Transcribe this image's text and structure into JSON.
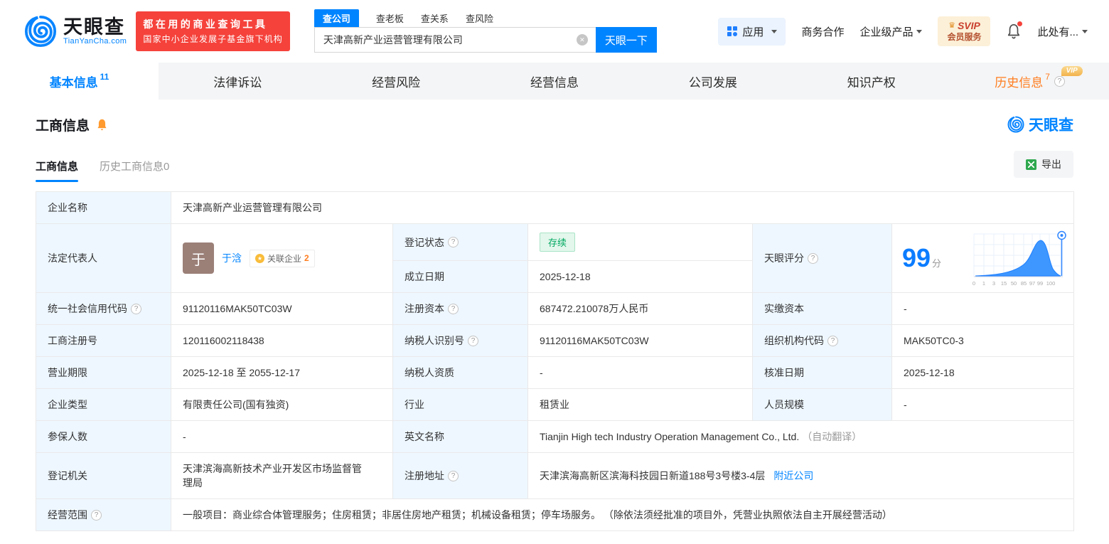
{
  "brand": {
    "name": "天眼查",
    "domain": "TianYanCha.com",
    "promo_line1": "都在用的商业查询工具",
    "promo_line2": "国家中小企业发展子基金旗下机构"
  },
  "search": {
    "tabs": [
      {
        "label": "查公司"
      },
      {
        "label": "查老板"
      },
      {
        "label": "查关系"
      },
      {
        "label": "查风险"
      }
    ],
    "value": "天津高新产业运营管理有限公司",
    "button_label": "天眼一下"
  },
  "header_nav": {
    "apps_label": "应用",
    "cooperation_label": "商务合作",
    "enterprise_label": "企业级产品",
    "svip_title": "SVIP",
    "svip_subtitle": "会员服务",
    "user_label": "此处有..."
  },
  "nav_tabs": [
    {
      "label": "基本信息",
      "count": "11"
    },
    {
      "label": "法律诉讼",
      "count": ""
    },
    {
      "label": "经营风险",
      "count": ""
    },
    {
      "label": "经营信息",
      "count": ""
    },
    {
      "label": "公司发展",
      "count": ""
    },
    {
      "label": "知识产权",
      "count": ""
    },
    {
      "label": "历史信息",
      "count": "7",
      "vip_tag": "VIP"
    }
  ],
  "section": {
    "title": "工商信息",
    "watermark": "天眼查",
    "subtab_active": "工商信息",
    "subtab_history": "历史工商信息0",
    "export_label": "导出"
  },
  "fields": {
    "company_name": {
      "label": "企业名称",
      "value": "天津高新产业运营管理有限公司"
    },
    "legal_rep": {
      "label": "法定代表人",
      "avatar_text": "于",
      "name": "于浛",
      "related_label": "关联企业",
      "related_count": "2"
    },
    "reg_status": {
      "label": "登记状态",
      "value": "存续"
    },
    "establish_date": {
      "label": "成立日期",
      "value": "2025-12-18"
    },
    "score": {
      "label": "天眼评分",
      "value": "99",
      "unit": "分",
      "axis": [
        "0",
        "1",
        "3",
        "15",
        "50",
        "85",
        "97",
        "99",
        "100"
      ]
    },
    "credit_code": {
      "label": "统一社会信用代码",
      "value": "91120116MAK50TC03W"
    },
    "reg_capital": {
      "label": "注册资本",
      "value": "687472.210078万人民币"
    },
    "paid_capital": {
      "label": "实缴资本",
      "value": "-"
    },
    "reg_number": {
      "label": "工商注册号",
      "value": "120116002118438"
    },
    "taxpayer_id": {
      "label": "纳税人识别号",
      "value": "91120116MAK50TC03W"
    },
    "org_code": {
      "label": "组织机构代码",
      "value": "MAK50TC0-3"
    },
    "business_term": {
      "label": "营业期限",
      "value": "2025-12-18 至 2055-12-17"
    },
    "taxpayer_qualification": {
      "label": "纳税人资质",
      "value": "-"
    },
    "approval_date": {
      "label": "核准日期",
      "value": "2025-12-18"
    },
    "company_type": {
      "label": "企业类型",
      "value": "有限责任公司(国有独资)"
    },
    "industry": {
      "label": "行业",
      "value": "租赁业"
    },
    "staff_size": {
      "label": "人员规模",
      "value": "-"
    },
    "insured_count": {
      "label": "参保人数",
      "value": "-"
    },
    "english_name": {
      "label": "英文名称",
      "value": "Tianjin High tech Industry Operation Management Co., Ltd.",
      "note": "（自动翻译）"
    },
    "registry": {
      "label": "登记机关",
      "value": "天津滨海高新技术产业开发区市场监督管理局"
    },
    "reg_address": {
      "label": "注册地址",
      "value": "天津滨海高新区滨海科技园日新道188号3号楼3-4层",
      "link": "附近公司"
    },
    "business_scope": {
      "label": "经营范围",
      "value": "一般项目：商业综合体管理服务；住房租赁；非居住房地产租赁；机械设备租赁；停车场服务。 （除依法须经批准的项目外，凭营业执照依法自主开展经营活动）"
    }
  },
  "colors": {
    "primary_blue": "#0084ff",
    "promo_red": "#f5423b",
    "history_orange": "#ff7d1f",
    "status_green": "#00a860",
    "label_cell_bg": "#eef7ff"
  }
}
